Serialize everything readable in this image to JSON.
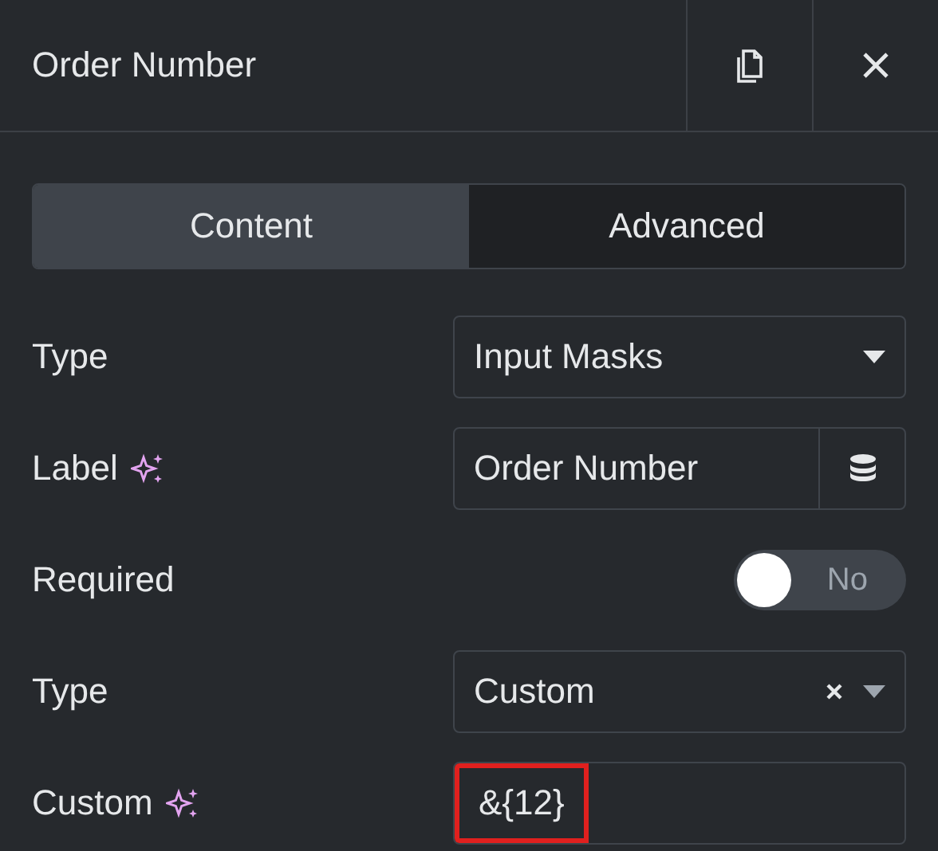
{
  "header": {
    "title": "Order Number"
  },
  "tabs": [
    {
      "label": "Content",
      "selected": true
    },
    {
      "label": "Advanced",
      "selected": false
    }
  ],
  "controls": [
    {
      "kind": "select",
      "label": "Type",
      "ai": false,
      "value": "Input Masks",
      "clearable": false
    },
    {
      "kind": "text",
      "label": "Label",
      "ai": true,
      "value": "Order Number",
      "dynamic": true,
      "highlighted": false
    },
    {
      "kind": "switch",
      "label": "Required",
      "on": false,
      "off_label": "No"
    },
    {
      "kind": "select",
      "label": "Type",
      "ai": false,
      "value": "Custom",
      "clearable": true
    },
    {
      "kind": "text",
      "label": "Custom",
      "ai": true,
      "value": "&{12}",
      "dynamic": false,
      "highlighted": true
    }
  ]
}
